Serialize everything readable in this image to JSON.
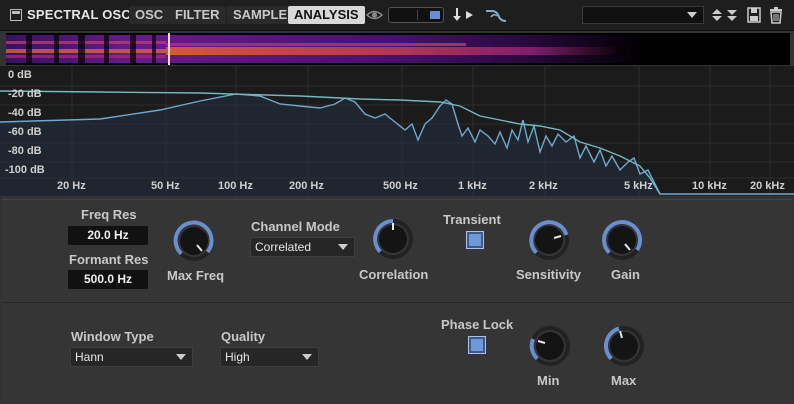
{
  "header": {
    "title": "SPECTRAL OSC",
    "tabs": [
      {
        "label": "OSC",
        "active": false
      },
      {
        "label": "FILTER",
        "active": false
      },
      {
        "label": "SAMPLE",
        "active": false
      },
      {
        "label": "ANALYSIS",
        "active": true
      }
    ],
    "preset_value": "",
    "icons": [
      "module-icon",
      "eye-icon",
      "toggle-switch",
      "in-out-icon",
      "waveform-icon",
      "dropdown-arrow-icon",
      "up-down-arrows-icon",
      "save-icon",
      "trash-icon"
    ]
  },
  "analyzer": {
    "db_labels": [
      "0 dB",
      "-20 dB",
      "-40 dB",
      "-60 dB",
      "-80 dB",
      "-100 dB"
    ],
    "hz_labels": [
      "20 Hz",
      "50 Hz",
      "100 Hz",
      "200 Hz",
      "500 Hz",
      "1 kHz",
      "2 kHz",
      "5 kHz",
      "10 kHz",
      "20 kHz"
    ]
  },
  "panel1": {
    "freq_res_label": "Freq Res",
    "freq_res_value": "20.0 Hz",
    "formant_res_label": "Formant Res",
    "formant_res_value": "500.0 Hz",
    "max_freq_label": "Max Freq",
    "channel_mode_label": "Channel Mode",
    "channel_mode_value": "Correlated",
    "correlation_label": "Correlation",
    "transient_label": "Transient",
    "transient_checked": true,
    "sensitivity_label": "Sensitivity",
    "gain_label": "Gain"
  },
  "panel2": {
    "window_type_label": "Window Type",
    "window_type_value": "Hann",
    "quality_label": "Quality",
    "quality_value": "High",
    "phase_lock_label": "Phase Lock",
    "phase_lock_checked": true,
    "min_label": "Min",
    "max_label": "Max"
  },
  "colors": {
    "accent": "#6f98d8",
    "knob_ring": "#6a8fd0",
    "curve": "#7fb0c8"
  }
}
